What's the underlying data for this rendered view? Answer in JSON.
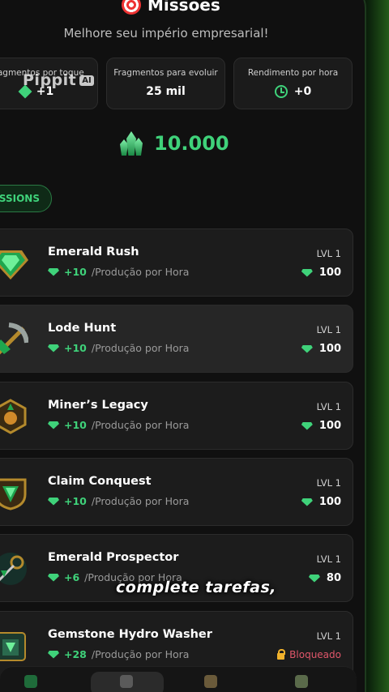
{
  "header": {
    "title": "Missões",
    "subtitle": "Melhore seu império empresarial!"
  },
  "stats": [
    {
      "label": "Fragmentos por toque",
      "value": "+1",
      "icon": "diamond-icon"
    },
    {
      "label": "Fragmentos para evoluir",
      "value": "25 mil",
      "icon": ""
    },
    {
      "label": "Rendimento por hora",
      "value": "+0",
      "icon": "clock-icon"
    }
  ],
  "watermark": {
    "text": "Pippit",
    "badge": "AI"
  },
  "balance": {
    "value": "10.000",
    "icon": "emerald-crystal-icon"
  },
  "tab": {
    "label": "MISSIONS"
  },
  "missions": [
    {
      "name": "Emerald Rush",
      "gain": "+10",
      "unit": "/Produção por Hora",
      "level": "LVL 1",
      "cost": "100",
      "locked": false,
      "icon": "emerald-gem-icon"
    },
    {
      "name": "Lode Hunt",
      "gain": "+10",
      "unit": "/Produção por Hora",
      "level": "LVL 1",
      "cost": "100",
      "locked": false,
      "icon": "pickaxe-icon"
    },
    {
      "name": "Miner’s Legacy",
      "gain": "+10",
      "unit": "/Produção por Hora",
      "level": "LVL 1",
      "cost": "100",
      "locked": false,
      "icon": "lantern-badge-icon"
    },
    {
      "name": "Claim Conquest",
      "gain": "+10",
      "unit": "/Produção por Hora",
      "level": "LVL 1",
      "cost": "100",
      "locked": false,
      "icon": "emerald-shield-icon"
    },
    {
      "name": "Emerald Prospector",
      "gain": "+6",
      "unit": "/Produção por Hora",
      "level": "LVL 1",
      "cost": "80",
      "locked": false,
      "icon": "prospector-tools-icon"
    },
    {
      "name": "Gemstone Hydro Washer",
      "gain": "+28",
      "unit": "/Produção por Hora",
      "level": "LVL 1",
      "cost": "",
      "locked": true,
      "locked_label": "Bloqueado",
      "icon": "hydro-washer-icon"
    }
  ],
  "caption": "complete tarefas,",
  "colors": {
    "accent": "#3fd27a",
    "card": "#1c1c1c",
    "locked": "#e0566a",
    "lock": "#f1b22c"
  }
}
